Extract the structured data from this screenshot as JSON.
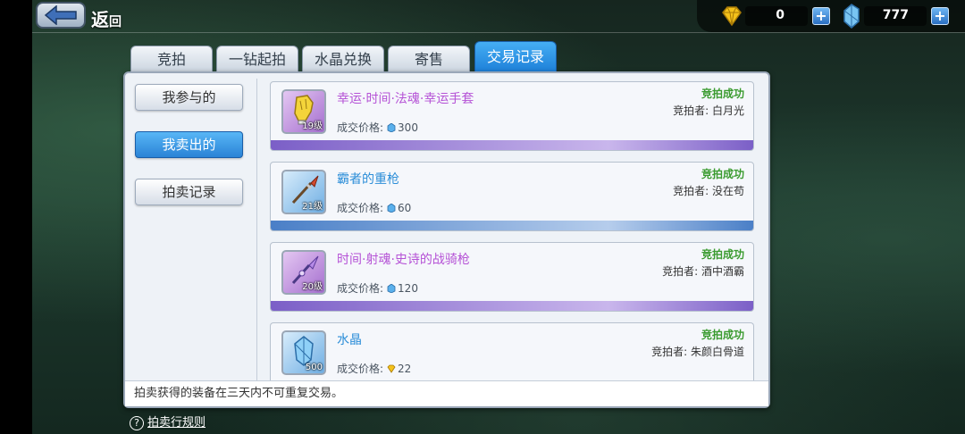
{
  "header": {
    "back_label": "返",
    "back_label_small": "回"
  },
  "currency": {
    "gold_value": "0",
    "crystal_value": "777",
    "plus": "+"
  },
  "tabs": [
    {
      "label": "竞拍"
    },
    {
      "label": "一钻起拍"
    },
    {
      "label": "水晶兑换"
    },
    {
      "label": "寄售"
    },
    {
      "label": "交易记录",
      "active": true
    }
  ],
  "sidebar": {
    "items": [
      {
        "label": "我参与的"
      },
      {
        "label": "我卖出的",
        "active": true
      },
      {
        "label": "拍卖记录"
      }
    ]
  },
  "records": [
    {
      "name": "幸运·时间·法魂·幸运手套",
      "level": "19级",
      "price_label": "成交价格:",
      "price": "300",
      "currency": "crystal",
      "status": "竞拍成功",
      "bidder": "竞拍者: 白月光",
      "rarity": "purple",
      "icon": "glove-icon"
    },
    {
      "name": "霸者的重枪",
      "level": "21级",
      "price_label": "成交价格:",
      "price": "60",
      "currency": "crystal",
      "status": "竞拍成功",
      "bidder": "竞拍者: 没在苟",
      "rarity": "blue",
      "icon": "spear-icon"
    },
    {
      "name": "时间·射魂·史诗的战骑枪",
      "level": "20级",
      "price_label": "成交价格:",
      "price": "120",
      "currency": "crystal",
      "status": "竞拍成功",
      "bidder": "竞拍者: 酒中酒霸",
      "rarity": "purple",
      "icon": "lance-icon"
    },
    {
      "name": "水晶",
      "level": "500",
      "price_label": "成交价格:",
      "price": "22",
      "currency": "gold",
      "status": "竞拍成功",
      "bidder": "竞拍者: 朱颜白骨道",
      "rarity": "blue",
      "icon": "crystal-icon"
    }
  ],
  "notice": "拍卖获得的装备在三天内不可重复交易。",
  "rules": {
    "qmark": "?",
    "label": "拍卖行规则"
  },
  "colors": {
    "accent": "#2a83d6",
    "success": "#3a9b2f",
    "epic": "#b552d6",
    "rare": "#2c8ed8"
  }
}
